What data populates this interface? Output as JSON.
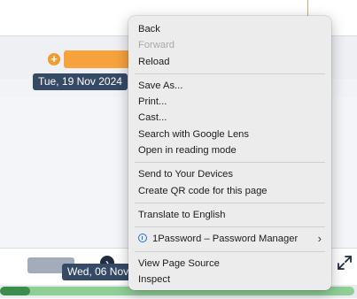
{
  "background": {
    "date_top": "Tue, 19 Nov 2024",
    "date_bottom": "Wed, 06 Nov"
  },
  "context_menu": {
    "group1": [
      {
        "label": "Back",
        "disabled": false
      },
      {
        "label": "Forward",
        "disabled": true
      },
      {
        "label": "Reload",
        "disabled": false
      }
    ],
    "group2": [
      {
        "label": "Save As..."
      },
      {
        "label": "Print..."
      },
      {
        "label": "Cast..."
      },
      {
        "label": "Search with Google Lens"
      },
      {
        "label": "Open in reading mode"
      }
    ],
    "group3": [
      {
        "label": "Send to Your Devices"
      },
      {
        "label": "Create QR code for this page"
      }
    ],
    "group4": [
      {
        "label": "Translate to English"
      }
    ],
    "group5": [
      {
        "label": "1Password – Password Manager",
        "icon": "info-circle-icon",
        "submenu": true
      }
    ],
    "group6": [
      {
        "label": "View Page Source"
      },
      {
        "label": "Inspect"
      }
    ]
  },
  "colors": {
    "accent_orange": "#f7a23c",
    "chip_navy": "#364a66",
    "extension_blue": "#1a73e8"
  }
}
